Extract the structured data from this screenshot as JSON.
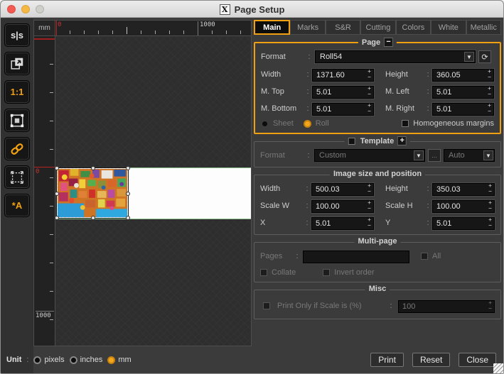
{
  "colon": ":",
  "icons": {
    "plus": "+",
    "minus": "−",
    "dropdown": "▼",
    "refresh": "⟳",
    "more": "...",
    "x11": "X"
  },
  "window": {
    "title": "Page Setup"
  },
  "sidebar": {
    "items": [
      {
        "name": "mirror-tool",
        "glyph": "s|s"
      },
      {
        "name": "export-tool",
        "glyph": ""
      },
      {
        "name": "one-to-one-zoom",
        "glyph": "1:1"
      },
      {
        "name": "selection-frame-tool",
        "glyph": ""
      },
      {
        "name": "link-dimensions",
        "glyph": ""
      },
      {
        "name": "fit-to-page",
        "glyph": ""
      },
      {
        "name": "text-annotation",
        "glyph": "*A"
      }
    ]
  },
  "canvas": {
    "unit_corner": "mm",
    "h_zero": "0",
    "h_thousand": "1000",
    "v_zero": "0",
    "v_thousand": "1000"
  },
  "tabs": [
    {
      "label": "Main"
    },
    {
      "label": "Marks"
    },
    {
      "label": "S&R"
    },
    {
      "label": "Cutting"
    },
    {
      "label": "Colors"
    },
    {
      "label": "White"
    },
    {
      "label": "Metallic"
    }
  ],
  "page_group": {
    "title": "Page",
    "format_label": "Format",
    "format_value": "Roll54",
    "fields": [
      {
        "label": "Width",
        "value": "1371.60"
      },
      {
        "label": "Height",
        "value": "360.05"
      },
      {
        "label": "M. Top",
        "value": "5.01"
      },
      {
        "label": "M. Left",
        "value": "5.01"
      },
      {
        "label": "M. Bottom",
        "value": "5.01"
      },
      {
        "label": "M. Right",
        "value": "5.01"
      }
    ],
    "sheet_label": "Sheet",
    "roll_label": "Roll",
    "homogeneous_label": "Homogeneous margins"
  },
  "template_group": {
    "title": "Template",
    "format_label": "Format",
    "format_value": "Custom",
    "mode_value": "Auto"
  },
  "image_group": {
    "title": "Image size and position",
    "fields": [
      {
        "label": "Width",
        "value": "500.03"
      },
      {
        "label": "Height",
        "value": "350.03"
      },
      {
        "label": "Scale W",
        "value": "100.00"
      },
      {
        "label": "Scale H",
        "value": "100.00"
      },
      {
        "label": "X",
        "value": "5.01"
      },
      {
        "label": "Y",
        "value": "5.01"
      }
    ]
  },
  "multipage_group": {
    "title": "Multi-page",
    "pages_label": "Pages",
    "pages_value": "",
    "all_label": "All",
    "collate_label": "Collate",
    "invert_label": "Invert order"
  },
  "misc_group": {
    "title": "Misc",
    "scale_label": "Print Only if Scale is (%)",
    "scale_value": "100"
  },
  "footer": {
    "unit_label": "Unit",
    "units": [
      {
        "label": "pixels"
      },
      {
        "label": "inches"
      },
      {
        "label": "mm"
      }
    ],
    "buttons": [
      "Print",
      "Reset",
      "Close"
    ]
  }
}
